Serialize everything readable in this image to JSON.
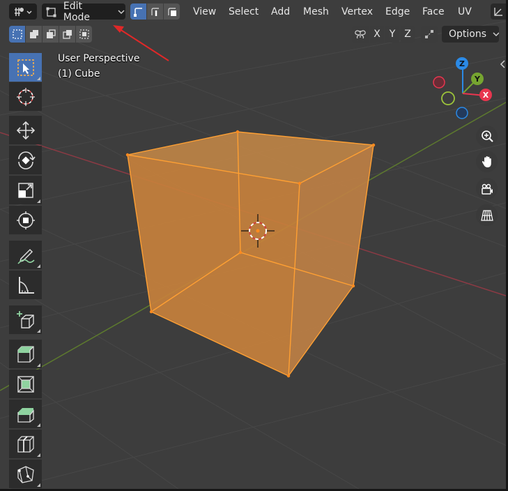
{
  "header": {
    "mode_label": "Edit Mode",
    "menus": [
      "View",
      "Select",
      "Add",
      "Mesh",
      "Vertex",
      "Edge",
      "Face",
      "UV"
    ]
  },
  "tool_header": {
    "axis_x": "X",
    "axis_y": "Y",
    "axis_z": "Z",
    "options_label": "Options"
  },
  "viewport": {
    "view_name": "User Perspective",
    "object_name": "(1) Cube"
  },
  "gizmo": {
    "z_label": "Z",
    "y_label": "Y",
    "x_label": "X",
    "colors": {
      "x": "#e8364f",
      "y": "#76a530",
      "z": "#2b8ae6"
    }
  },
  "colors": {
    "accent": "#4772b3",
    "selection": "#ffa033",
    "annotation_arrow": "#e02828"
  },
  "icons": {
    "editor_type": "editor-type-icon",
    "mode": "edit-mode-icon",
    "toolbar": [
      "select-box-icon",
      "cursor-icon",
      "move-icon",
      "rotate-icon",
      "scale-icon",
      "transform-icon",
      "annotate-icon",
      "measure-icon",
      "add-cube-icon",
      "extrude-region-icon",
      "inset-faces-icon",
      "bevel-icon",
      "loop-cut-icon",
      "knife-icon"
    ]
  }
}
